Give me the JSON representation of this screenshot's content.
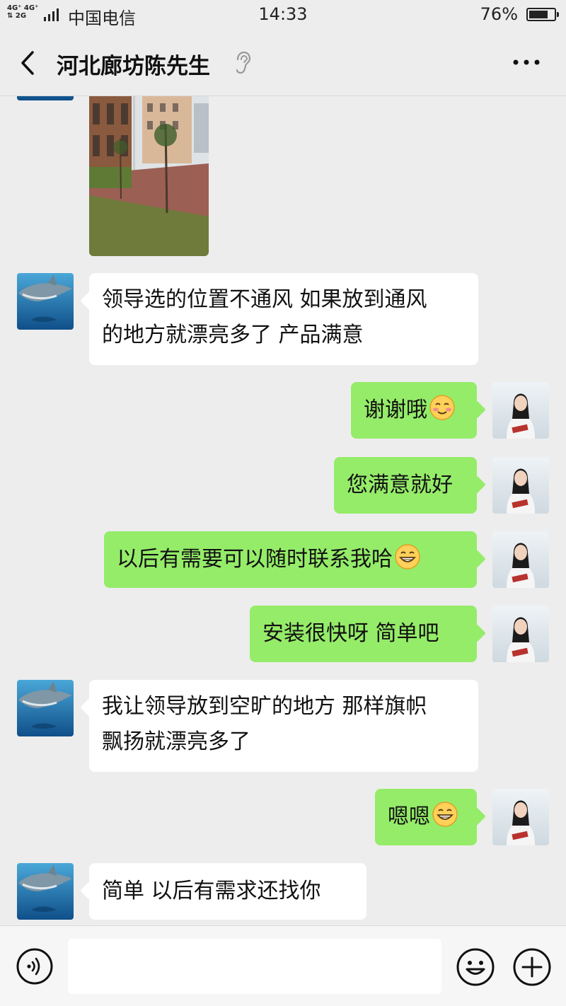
{
  "status_bar": {
    "network_1": "4G⁺ 4G⁺",
    "network_2": "⇅ 2G",
    "carrier": "中国电信",
    "time": "14:33",
    "battery": "76%",
    "battery_level": 0.76
  },
  "header": {
    "title": "河北廊坊陈先生"
  },
  "messages": [
    {
      "side": "in",
      "type": "image"
    },
    {
      "side": "in",
      "type": "text",
      "lines": [
        "领导选的位置不通风 如果放到通风",
        "的地方就漂亮多了 产品满意"
      ]
    },
    {
      "side": "out",
      "type": "text",
      "text": "谢谢哦",
      "emoji": "blush-emoji"
    },
    {
      "side": "out",
      "type": "text",
      "text": "您满意就好"
    },
    {
      "side": "out",
      "type": "text",
      "text": "以后有需要可以随时联系我哈",
      "emoji": "grin-emoji"
    },
    {
      "side": "out",
      "type": "text",
      "text": "安装很快呀  简单吧"
    },
    {
      "side": "in",
      "type": "text",
      "lines": [
        "我让领导放到空旷的地方 那样旗帜",
        "飘扬就漂亮多了"
      ]
    },
    {
      "side": "out",
      "type": "text",
      "text": "嗯嗯",
      "emoji": "grin-emoji"
    },
    {
      "side": "in",
      "type": "text",
      "text": "简单  以后有需求还找你"
    }
  ],
  "icons": {
    "back": "back-arrow-icon",
    "ear": "ear-icon",
    "more": "more-icon",
    "voice": "voice-icon",
    "emoji": "emoji-icon",
    "plus": "plus-icon"
  },
  "input": {
    "value": ""
  },
  "colors": {
    "background": "#ededed",
    "outgoing_bubble": "#95ec69",
    "incoming_bubble": "#ffffff"
  }
}
